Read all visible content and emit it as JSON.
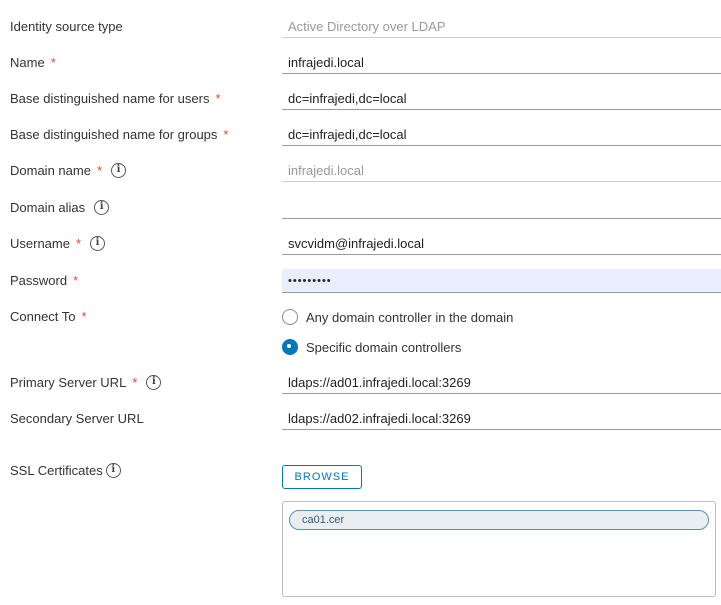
{
  "form": {
    "identity_source_type": {
      "label": "Identity source type",
      "value": "Active Directory over LDAP"
    },
    "name": {
      "label": "Name",
      "required": "*",
      "value": "infrajedi.local"
    },
    "base_dn_users": {
      "label": "Base distinguished name for users",
      "required": "*",
      "value": "dc=infrajedi,dc=local"
    },
    "base_dn_groups": {
      "label": "Base distinguished name for groups",
      "required": "*",
      "value": "dc=infrajedi,dc=local"
    },
    "domain_name": {
      "label": "Domain name",
      "required": "*",
      "info": "i",
      "value": "infrajedi.local"
    },
    "domain_alias": {
      "label": "Domain alias",
      "info": "i",
      "value": ""
    },
    "username": {
      "label": "Username",
      "required": "*",
      "info": "i",
      "value": "svcvidm@infrajedi.local"
    },
    "password": {
      "label": "Password",
      "required": "*",
      "value": "•••••••••"
    },
    "connect_to": {
      "label": "Connect To",
      "required": "*",
      "options": [
        {
          "label": "Any domain controller in the domain",
          "selected": false
        },
        {
          "label": "Specific domain controllers",
          "selected": true
        }
      ]
    },
    "primary_server_url": {
      "label": "Primary Server URL",
      "required": "*",
      "info": "i",
      "value": "ldaps://ad01.infrajedi.local:3269"
    },
    "secondary_server_url": {
      "label": "Secondary Server URL",
      "value": "ldaps://ad02.infrajedi.local:3269"
    },
    "ssl_certificates": {
      "label": "SSL Certificates",
      "info": "i",
      "browse_label": "BROWSE",
      "files": [
        "ca01.cer"
      ]
    }
  },
  "colors": {
    "accent": "#0079b8",
    "required": "#db4a28",
    "password_bg": "#e8eefb"
  }
}
